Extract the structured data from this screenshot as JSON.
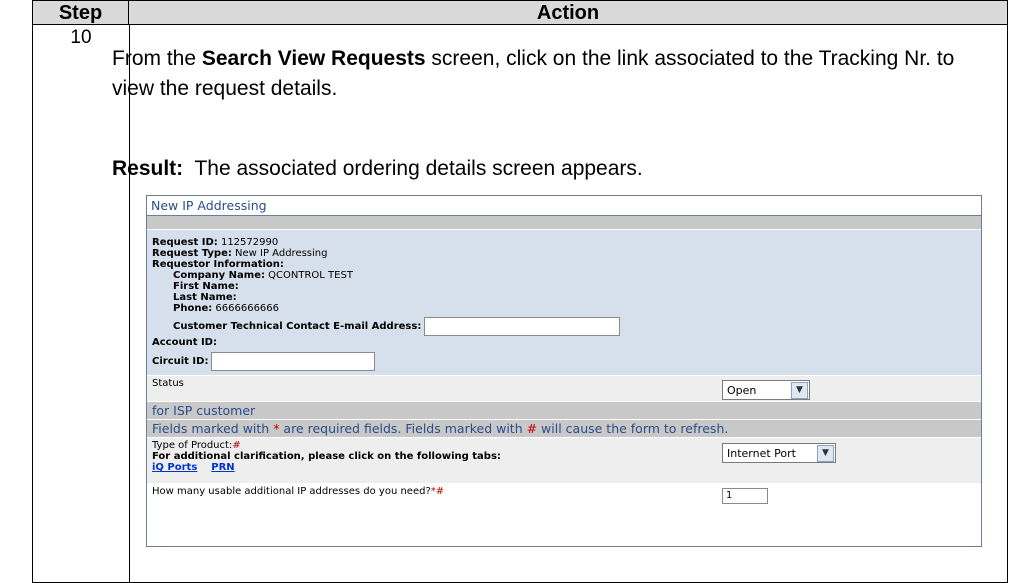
{
  "table": {
    "header_step": "Step",
    "header_action": "Action",
    "step_number": "10"
  },
  "action": {
    "part1": "From the ",
    "bold_screen": "Search View Requests",
    "part2": " screen, click on the link associated to the Tracking Nr. to view the request details."
  },
  "result": {
    "label": "Result:",
    "text": "  The associated ordering details screen appears."
  },
  "form": {
    "title": "New IP Addressing",
    "request_id_label": "Request ID:",
    "request_id": " 112572990",
    "request_type_label": "Request Type:",
    "request_type": " New IP Addressing",
    "requestor_info_label": "Requestor Information:",
    "company_name_label": "Company Name:",
    "company_name": " QCONTROL TEST",
    "first_name_label": "First Name:",
    "last_name_label": "Last Name:",
    "phone_label": "Phone:",
    "phone": " 6666666666",
    "tech_email_label": "Customer Technical Contact E-mail Address:",
    "tech_email_value": "",
    "account_id_label": "Account ID:",
    "circuit_id_label": "Circuit ID:",
    "circuit_id_value": "",
    "status_label": "Status",
    "status_value": "Open",
    "section_isp": "for ISP customer",
    "required_note_1": "Fields marked with ",
    "required_star": "*",
    "required_note_2": " are required fields. Fields marked with ",
    "required_hash": "#",
    "required_note_3": " will cause the form to refresh.",
    "product_label": "Type of Product:",
    "product_marker": "#",
    "clarification": "For additional clarification, please click on the following tabs:",
    "link_iq_ports": "iQ Ports",
    "link_prn": "PRN",
    "product_value": "Internet Port",
    "ip_question": "How many usable additional IP addresses do you need?",
    "ip_markers": "*#",
    "ip_value": "1"
  }
}
